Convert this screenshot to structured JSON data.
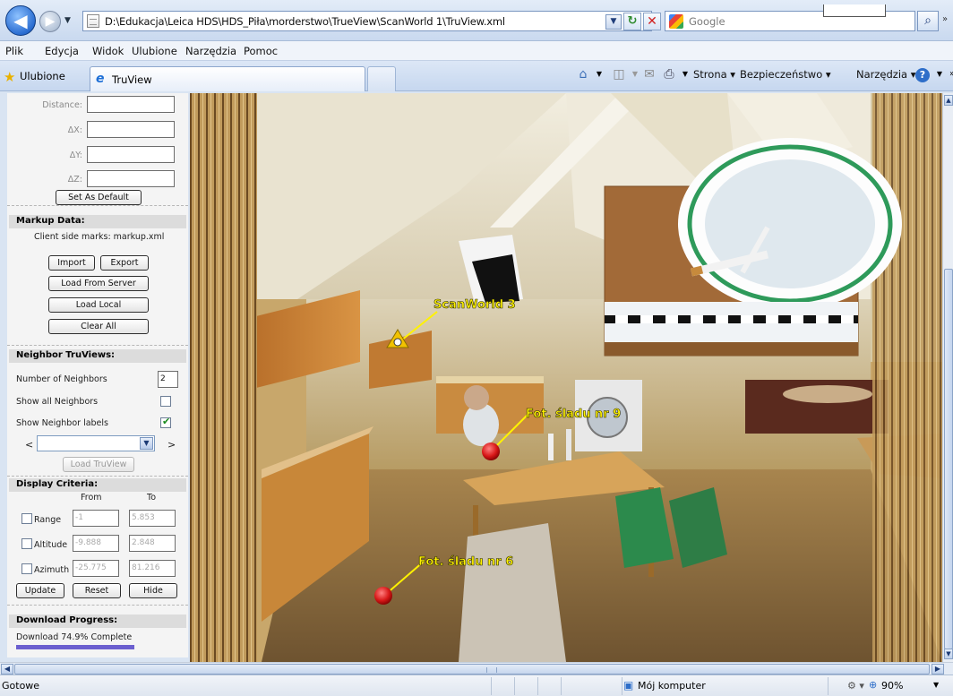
{
  "browser": {
    "address": "D:\\Edukacja\\Leica HDS\\HDS_Piła\\morderstwo\\TrueView\\ScanWorld 1\\TruView.xml",
    "search_placeholder": "Google",
    "menu": [
      "Plik",
      "Edycja",
      "Widok",
      "Ulubione",
      "Narzędzia",
      "Pomoc"
    ],
    "favorites_label": "Ulubione",
    "tab_title": "TruView",
    "commands": {
      "page": "Strona",
      "security": "Bezpieczeństwo",
      "tools": "Narzędzia"
    }
  },
  "measure": {
    "labels": [
      "Distance:",
      "ΔX:",
      "ΔY:",
      "ΔZ:"
    ],
    "set_default_label": "Set As Default"
  },
  "markup": {
    "title": "Markup Data:",
    "client_marks": "Client side marks: markup.xml",
    "import_label": "Import",
    "export_label": "Export",
    "load_server_label": "Load From Server",
    "load_local_label": "Load Local",
    "clear_all_label": "Clear All"
  },
  "neighbors": {
    "title": "Neighbor TruViews:",
    "count_label": "Number of Neighbors",
    "count_value": "2",
    "show_all_label": "Show all Neighbors",
    "show_all": false,
    "show_labels_label": "Show Neighbor labels",
    "show_labels": true,
    "prev": "<",
    "next": ">",
    "load_label": "Load TruView"
  },
  "criteria": {
    "title": "Display Criteria:",
    "from_label": "From",
    "to_label": "To",
    "rows": [
      {
        "label": "Range",
        "from": "-1",
        "to": "5.853"
      },
      {
        "label": "Altitude",
        "from": "-9.888",
        "to": "2.848"
      },
      {
        "label": "Azimuth",
        "from": "-25.775",
        "to": "81.216"
      }
    ],
    "update_label": "Update",
    "reset_label": "Reset",
    "hide_label": "Hide"
  },
  "download": {
    "title": "Download Progress:",
    "text": "Download 74.9% Complete",
    "progress": 0.749
  },
  "markers": {
    "scanworld": "ScanWorld 3",
    "trace9": "Fot. śladu nr 9",
    "trace6": "Fot. śladu nr 6"
  },
  "status": {
    "text": "Gotowe",
    "zone": "Mój komputer",
    "zoom": "90%"
  },
  "colors": {
    "marker_label": "#fff200",
    "progress_bar": "#6b5fcf"
  }
}
